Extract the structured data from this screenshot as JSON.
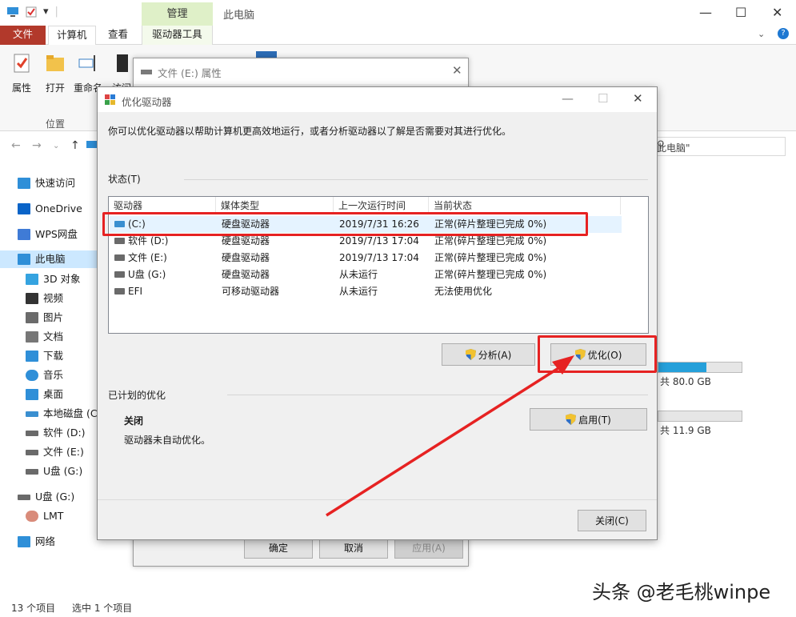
{
  "explorer": {
    "title": "此电脑",
    "context_tab_header": "管理",
    "tabs": {
      "file": "文件",
      "computer": "计算机",
      "view": "查看",
      "drive_tools": "驱动器工具"
    },
    "ribbon": {
      "properties": "属性",
      "open": "打开",
      "rename": "重命名",
      "access": "访问",
      "group_location": "位置"
    },
    "search_placeholder": "此电脑\"",
    "nav": [
      {
        "label": "快速访问",
        "icon": "star-icon"
      },
      {
        "label": "OneDrive",
        "icon": "cloud-icon"
      },
      {
        "label": "WPS网盘",
        "icon": "wps-cloud-icon"
      },
      {
        "label": "此电脑",
        "icon": "computer-icon"
      },
      {
        "label": "3D 对象",
        "icon": "cube-icon"
      },
      {
        "label": "视频",
        "icon": "video-icon"
      },
      {
        "label": "图片",
        "icon": "picture-icon"
      },
      {
        "label": "文档",
        "icon": "document-icon"
      },
      {
        "label": "下载",
        "icon": "download-icon"
      },
      {
        "label": "音乐",
        "icon": "music-icon"
      },
      {
        "label": "桌面",
        "icon": "desktop-icon"
      },
      {
        "label": "本地磁盘 (C:",
        "icon": "system-drive-icon"
      },
      {
        "label": "软件 (D:)",
        "icon": "drive-icon"
      },
      {
        "label": "文件 (E:)",
        "icon": "drive-icon"
      },
      {
        "label": "U盘 (G:)",
        "icon": "drive-icon"
      },
      {
        "label": "U盘 (G:)",
        "icon": "usb-drive-icon"
      },
      {
        "label": "LMT",
        "icon": "user-icon"
      },
      {
        "label": "网络",
        "icon": "network-icon"
      }
    ],
    "right_pane": {
      "total1": "共 80.0 GB",
      "total2": "共 11.9 GB",
      "bar1_fraction": 0.58,
      "bar2_fraction": 0.0
    },
    "status": {
      "item_count": "13 个项目",
      "selected": "选中 1 个项目"
    }
  },
  "properties_dialog": {
    "title": "文件 (E:) 属性",
    "ok": "确定",
    "cancel": "取消",
    "apply": "应用(A)"
  },
  "optimize_dialog": {
    "title": "优化驱动器",
    "description": "你可以优化驱动器以帮助计算机更高效地运行，或者分析驱动器以了解是否需要对其进行优化。",
    "status_label": "状态(T)",
    "columns": [
      "驱动器",
      "媒体类型",
      "上一次运行时间",
      "当前状态"
    ],
    "rows": [
      {
        "drive": "(C:)",
        "media": "硬盘驱动器",
        "last_run": "2019/7/31 16:26",
        "status": "正常(碎片整理已完成 0%)",
        "system": true
      },
      {
        "drive": "软件 (D:)",
        "media": "硬盘驱动器",
        "last_run": "2019/7/13 17:04",
        "status": "正常(碎片整理已完成 0%)",
        "system": false
      },
      {
        "drive": "文件 (E:)",
        "media": "硬盘驱动器",
        "last_run": "2019/7/13 17:04",
        "status": "正常(碎片整理已完成 0%)",
        "system": false
      },
      {
        "drive": "U盘 (G:)",
        "media": "硬盘驱动器",
        "last_run": "从未运行",
        "status": "正常(碎片整理已完成 0%)",
        "system": false
      },
      {
        "drive": "EFI",
        "media": "可移动驱动器",
        "last_run": "从未运行",
        "status": "无法使用优化",
        "system": false
      }
    ],
    "analyze": "分析(A)",
    "optimize": "优化(O)",
    "scheduled_label": "已计划的优化",
    "scheduled_state": "关闭",
    "scheduled_desc": "驱动器未自动优化。",
    "enable": "启用(T)",
    "close": "关闭(C)"
  },
  "watermark": "头条 @老毛桃winpe",
  "colors": {
    "accent_red": "#e62222",
    "file_tab": "#b2392b",
    "selection": "#cce8ff",
    "ctx_tab": "#dff0c8"
  }
}
